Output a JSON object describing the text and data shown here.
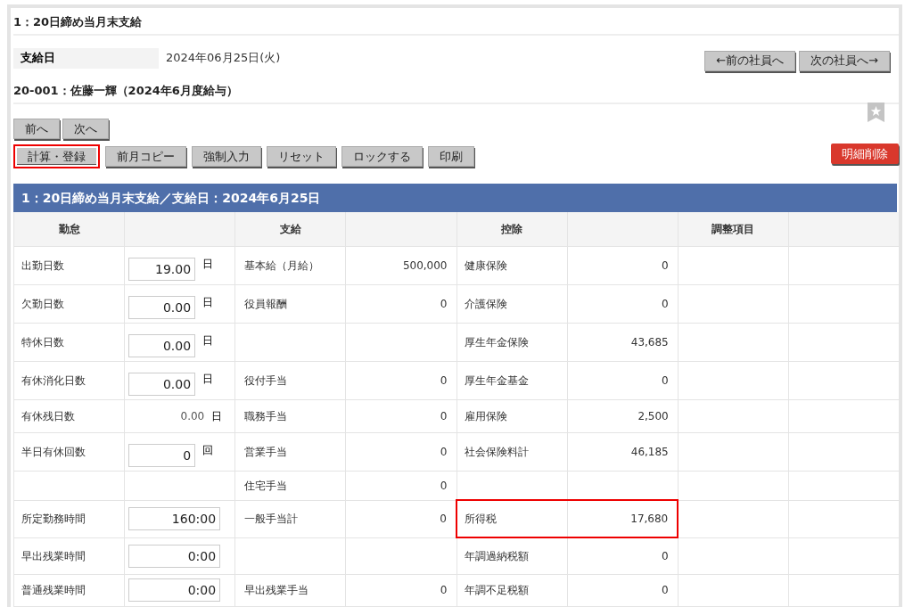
{
  "title": "1：20日締め当月末支給",
  "pay_date": {
    "label": "支給日",
    "value": "2024年06月25日(火)"
  },
  "employee_nav": [
    "←前の社員へ",
    "次の社員へ→"
  ],
  "employee_heading": "20-001：佐藤一輝（2024年6月度給与）",
  "page_nav": [
    "前へ",
    "次へ"
  ],
  "actions": [
    {
      "label": "計算・登録",
      "highlighted": true
    },
    {
      "label": "前月コピー",
      "highlighted": false
    },
    {
      "label": "強制入力",
      "highlighted": false
    },
    {
      "label": "リセット",
      "highlighted": false
    },
    {
      "label": "ロックする",
      "highlighted": false
    },
    {
      "label": "印刷",
      "highlighted": false
    }
  ],
  "delete_button": "明細削除",
  "table": {
    "title": "1：20日締め当月末支給／支給日：2024年6月25日",
    "columns": [
      "勤怠",
      "支給",
      "控除",
      "調整項目"
    ],
    "rows": [
      {
        "attendance": {
          "label": "出勤日数",
          "kind": "input",
          "value": "19.00",
          "unit": "日"
        },
        "pay": {
          "label": "基本給（月給）",
          "amount": "500,000"
        },
        "deduction": {
          "label": "健康保険",
          "amount": "0",
          "highlighted": false
        }
      },
      {
        "attendance": {
          "label": "欠勤日数",
          "kind": "input",
          "value": "0.00",
          "unit": "日"
        },
        "pay": {
          "label": "役員報酬",
          "amount": "0"
        },
        "deduction": {
          "label": "介護保険",
          "amount": "0",
          "highlighted": false
        }
      },
      {
        "attendance": {
          "label": "特休日数",
          "kind": "input",
          "value": "0.00",
          "unit": "日"
        },
        "deduction": {
          "label": "厚生年金保険",
          "amount": "43,685",
          "highlighted": false
        }
      },
      {
        "attendance": {
          "label": "有休消化日数",
          "kind": "input",
          "value": "0.00",
          "unit": "日"
        },
        "pay": {
          "label": "役付手当",
          "amount": "0"
        },
        "deduction": {
          "label": "厚生年金基金",
          "amount": "0",
          "highlighted": false
        }
      },
      {
        "attendance": {
          "label": "有休残日数",
          "kind": "text",
          "value": "0.00",
          "unit": "日"
        },
        "pay": {
          "label": "職務手当",
          "amount": "0"
        },
        "deduction": {
          "label": "雇用保険",
          "amount": "2,500",
          "highlighted": false
        }
      },
      {
        "attendance": {
          "label": "半日有休回数",
          "kind": "input",
          "value": "0",
          "unit": "回"
        },
        "pay": {
          "label": "営業手当",
          "amount": "0"
        },
        "deduction": {
          "label": "社会保険料計",
          "amount": "46,185",
          "highlighted": false
        }
      },
      {
        "pay": {
          "label": "住宅手当",
          "amount": "0"
        }
      },
      {
        "attendance": {
          "label": "所定勤務時間",
          "kind": "time",
          "value": "160:00"
        },
        "pay": {
          "label": "一般手当計",
          "amount": "0"
        },
        "deduction": {
          "label": "所得税",
          "amount": "17,680",
          "highlighted": true
        }
      },
      {
        "attendance": {
          "label": "早出残業時間",
          "kind": "time",
          "value": "0:00"
        },
        "deduction": {
          "label": "年調過納税額",
          "amount": "0",
          "highlighted": false
        }
      },
      {
        "attendance": {
          "label": "普通残業時間",
          "kind": "time",
          "value": "0:00"
        },
        "pay": {
          "label": "早出残業手当",
          "amount": "0"
        },
        "deduction": {
          "label": "年調不足税額",
          "amount": "0",
          "highlighted": false
        }
      }
    ]
  }
}
